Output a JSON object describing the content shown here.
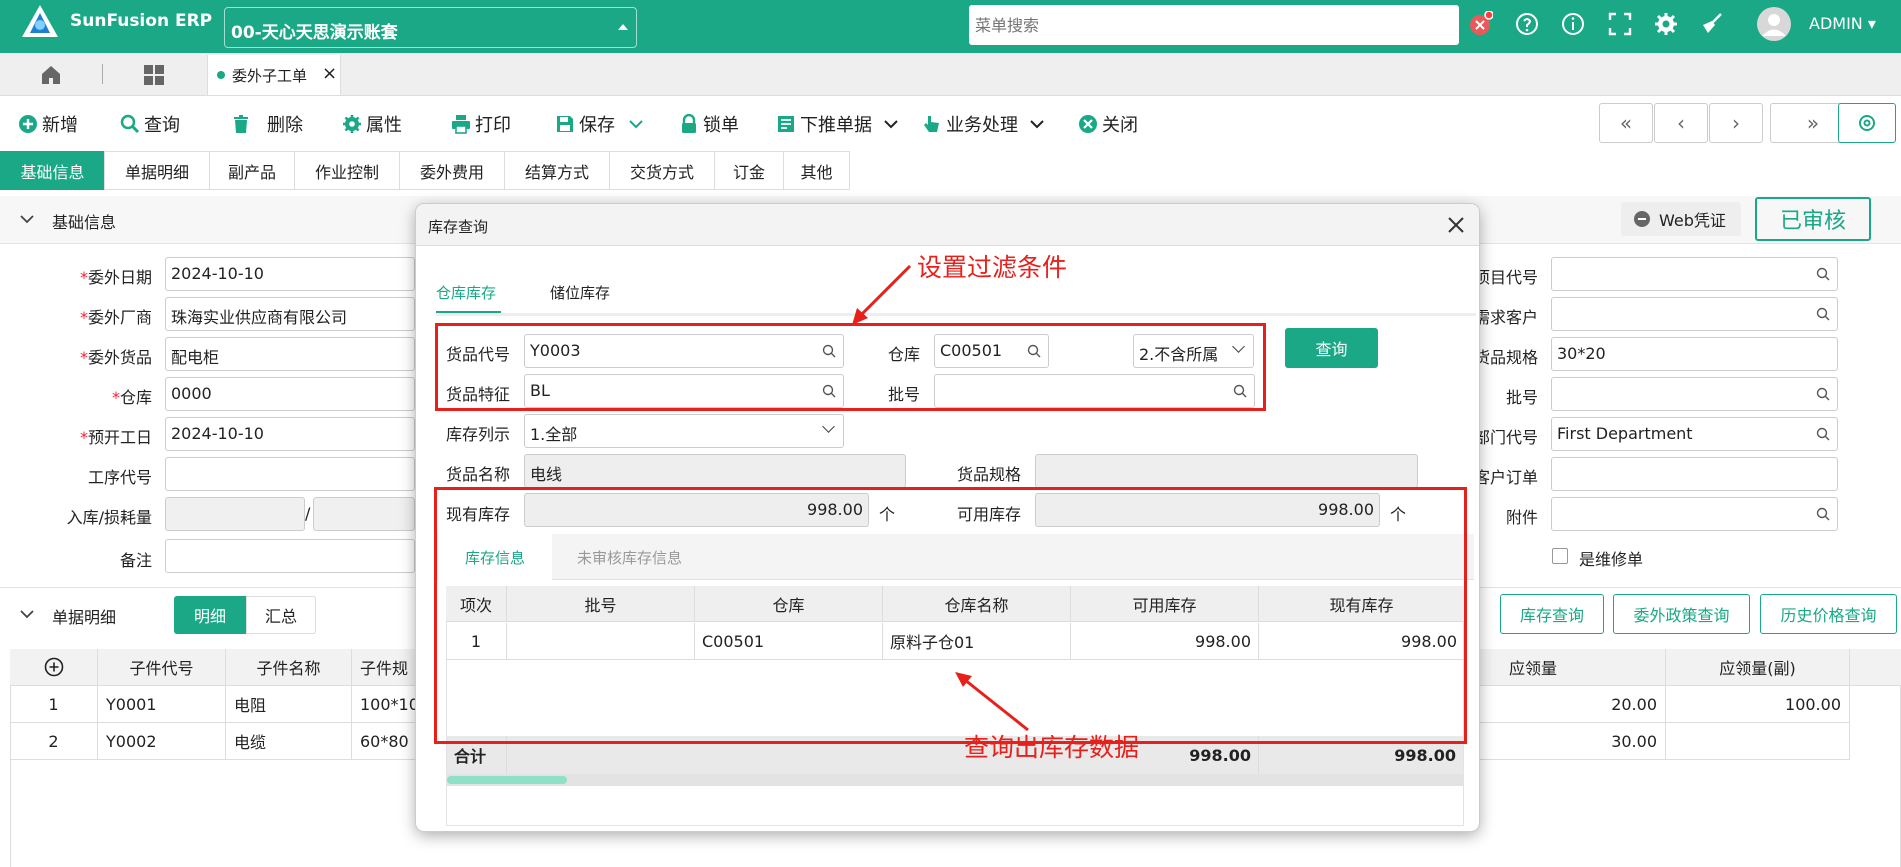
{
  "app": {
    "title": "SunFusion ERP",
    "account": "00-天心天思演示账套",
    "search_placeholder": "菜单搜索",
    "user": "ADMIN"
  },
  "tabs": {
    "doc_tab": "委外子工单"
  },
  "toolbar": {
    "add": "新增",
    "query": "查询",
    "delete": "删除",
    "props": "属性",
    "print": "打印",
    "save": "保存",
    "lock": "锁单",
    "push": "下推单据",
    "business": "业务处理",
    "close": "关闭"
  },
  "form_tabs": [
    "基础信息",
    "单据明细",
    "副产品",
    "作业控制",
    "委外费用",
    "结算方式",
    "交货方式",
    "订金",
    "其他"
  ],
  "basic": {
    "section_title": "基础信息",
    "web_voucher": "Web凭证",
    "status": "已审核",
    "left_fields": [
      {
        "label": "委外日期",
        "value": "2024-10-10",
        "required": true
      },
      {
        "label": "委外厂商",
        "value": "珠海实业供应商有限公司",
        "required": true
      },
      {
        "label": "委外货品",
        "value": "配电柜",
        "required": true
      },
      {
        "label": "仓库",
        "value": "0000",
        "required": true
      },
      {
        "label": "预开工日",
        "value": "2024-10-10",
        "required": true
      },
      {
        "label": "工序代号",
        "value": "",
        "required": false
      },
      {
        "label": "入库/损耗量",
        "value": "",
        "required": false
      },
      {
        "label": "备注",
        "value": "",
        "required": false
      }
    ],
    "right_fields": [
      {
        "label": "项目代号",
        "value": ""
      },
      {
        "label": "需求客户",
        "value": ""
      },
      {
        "label": "货品规格",
        "value": "30*20"
      },
      {
        "label": "批号",
        "value": ""
      },
      {
        "label": "部门代号",
        "value": "First Department"
      },
      {
        "label": "客户订单",
        "value": ""
      },
      {
        "label": "附件",
        "value": ""
      }
    ],
    "repair_checkbox": "是维修单"
  },
  "detail": {
    "section_title": "单据明细",
    "toggle_detail": "明细",
    "toggle_summary": "汇总",
    "buttons": [
      "库存查询",
      "委外政策查询",
      "历史价格查询"
    ],
    "columns_left": [
      "子件代号",
      "子件名称",
      "子件规"
    ],
    "columns_right": [
      "应领量",
      "应领量(副)"
    ],
    "rows": [
      {
        "no": "1",
        "code": "Y0001",
        "name": "电阻",
        "spec": "100*10",
        "qty": "20.00",
        "qty2": "100.00"
      },
      {
        "no": "2",
        "code": "Y0002",
        "name": "电缆",
        "spec": "60*80",
        "qty": "30.00",
        "qty2": ""
      }
    ]
  },
  "dialog": {
    "title": "库存查询",
    "tab_active": "仓库库存",
    "tab_other": "储位库存",
    "item_code_label": "货品代号",
    "item_code": "Y0003",
    "warehouse_label": "仓库",
    "warehouse": "C00501",
    "scope": "2.不含所属",
    "query_button": "查询",
    "feature_label": "货品特征",
    "feature": "BL",
    "batch_label": "批号",
    "batch": "",
    "list_label": "库存列示",
    "list_value": "1.全部",
    "item_name_label": "货品名称",
    "item_name": "电线",
    "item_spec_label": "货品规格",
    "item_spec": "",
    "onhand_label": "现有库存",
    "onhand": "998.00",
    "unit": "个",
    "available_label": "可用库存",
    "available": "998.00",
    "inner_tab_active": "库存信息",
    "inner_tab_other": "未审核库存信息",
    "columns": [
      "项次",
      "批号",
      "仓库",
      "仓库名称",
      "可用库存",
      "现有库存"
    ],
    "rows": [
      {
        "no": "1",
        "batch": "",
        "wh": "C00501",
        "wh_name": "原料子仓01",
        "available": "998.00",
        "onhand": "998.00"
      }
    ],
    "total_label": "合计",
    "total_available": "998.00",
    "total_onhand": "998.00",
    "annotation_filter": "设置过滤条件",
    "annotation_result": "查询出库存数据"
  }
}
